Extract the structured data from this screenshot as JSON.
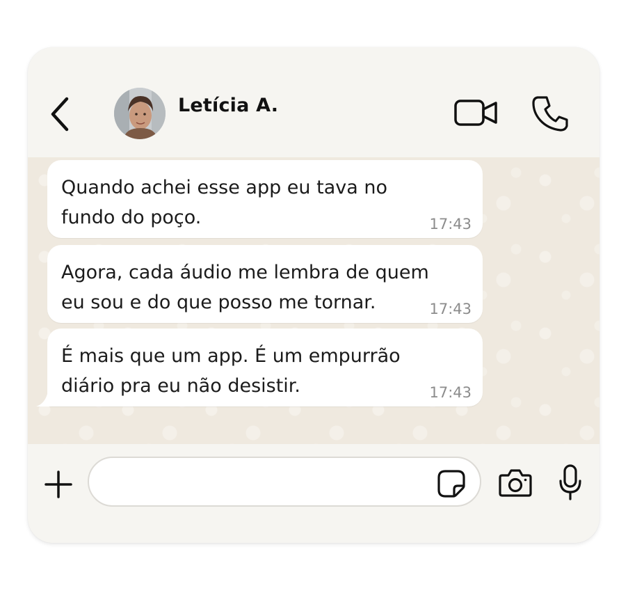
{
  "header": {
    "contact_name": "Letícia A."
  },
  "messages": [
    {
      "text": "Quando achei esse app eu tava no\nfundo do poço.",
      "time": "17:43"
    },
    {
      "text": "Agora, cada áudio me lembra de quem\neu sou e do que posso me tornar.",
      "time": "17:43"
    },
    {
      "text": "É mais que um app. É um empurrão\ndiário pra eu não desistir.",
      "time": "17:43"
    }
  ],
  "composer": {
    "placeholder": ""
  },
  "icons": {
    "back": "chevron-left-icon",
    "video": "video-camera-icon",
    "call": "phone-icon",
    "attach": "plus-icon",
    "sticker": "sticker-icon",
    "camera": "camera-icon",
    "mic": "microphone-icon"
  },
  "colors": {
    "card_background": "#f6f5f1",
    "chat_background": "#efe9df",
    "bubble_background": "#ffffff",
    "timestamp": "#8c8c8c",
    "icon": "#111111"
  }
}
